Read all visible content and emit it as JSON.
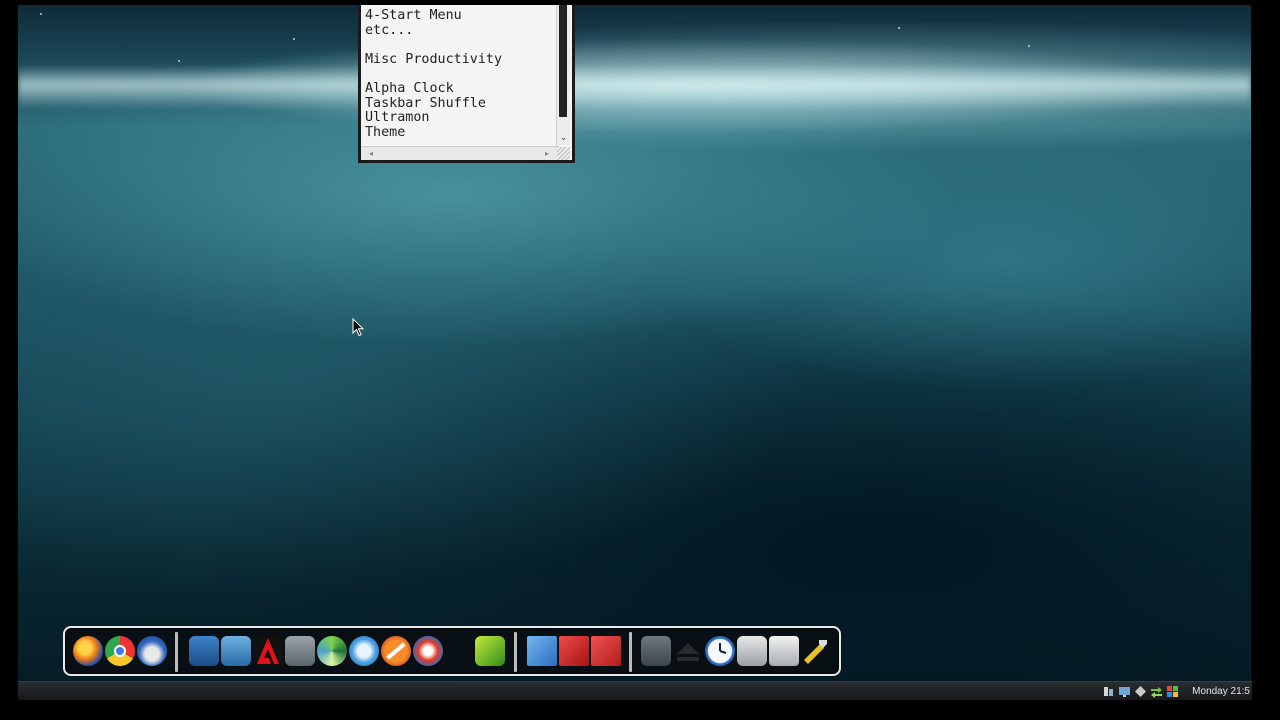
{
  "note_window": {
    "lines": [
      "4-Start Menu",
      "etc...",
      "",
      "Misc Productivity",
      "",
      "Alpha Clock",
      "Taskbar Shuffle",
      "Ultramon",
      "Theme"
    ]
  },
  "dock": {
    "icons": [
      {
        "name": "firefox-icon"
      },
      {
        "name": "chrome-icon"
      },
      {
        "name": "thunderbird-icon"
      },
      {
        "name": "xp-folder-icon"
      },
      {
        "name": "blue-app-icon"
      },
      {
        "name": "adobe-icon"
      },
      {
        "name": "dreamweaver-folder-icon"
      },
      {
        "name": "green-swirl-icon"
      },
      {
        "name": "itunes-icon"
      },
      {
        "name": "no-entry-app-icon"
      },
      {
        "name": "rss-feed-icon"
      },
      {
        "name": "green-chart-icon"
      },
      {
        "name": "blue-document-icon"
      },
      {
        "name": "red-film-icon"
      },
      {
        "name": "red-document-icon"
      },
      {
        "name": "dark-folder-icon"
      },
      {
        "name": "eject-icon"
      },
      {
        "name": "clock-icon"
      },
      {
        "name": "vault-icon"
      },
      {
        "name": "recycle-bin-icon"
      },
      {
        "name": "tools-icon"
      }
    ]
  },
  "taskbar": {
    "clock": "Monday 21:5",
    "tray_icons": [
      "network-icon",
      "monitor-icon",
      "diamond-icon",
      "shuffle-icon",
      "windows-flag-icon"
    ]
  },
  "colors": {
    "dock_border": "#e8e8e8",
    "taskbar": "#1c1e21",
    "note_bg": "#f4f4f4"
  }
}
